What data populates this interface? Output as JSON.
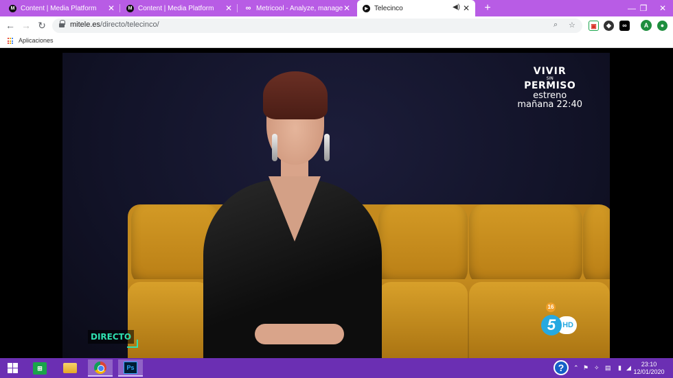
{
  "browser": {
    "tabs": [
      {
        "title": "Content | Media Platform",
        "favicon": "M"
      },
      {
        "title": "Content | Media Platform",
        "favicon": "M"
      },
      {
        "title": "Metricool - Analyze, manage and",
        "favicon": "∞"
      },
      {
        "title": "Telecinco",
        "favicon": "▶",
        "active": true
      }
    ],
    "new_tab": "+",
    "window_controls": {
      "minimize": "—",
      "restore": "❐",
      "close": "✕"
    },
    "address": {
      "domain": "mitele.es",
      "path": "/directo/telecinco/"
    },
    "profile_initial": "A",
    "bookmarks": {
      "apps_label": "Aplicaciones"
    }
  },
  "video": {
    "promo": {
      "line1": "VIVIR",
      "line2": "SIN",
      "line3": "PERMISO",
      "line4": "estreno",
      "line5": "mañana 22:40"
    },
    "live_label": "DIRECTO",
    "age_rating": "16",
    "channel_number": "5",
    "channel_hd": "HD"
  },
  "taskbar": {
    "store_label": "⊞",
    "ps_label": "Ps",
    "help_label": "?",
    "clock": {
      "time": "23:10",
      "date": "12/01/2020"
    }
  },
  "colors": {
    "tabstrip": "#b85ce5",
    "taskbar": "#6b2fb3",
    "live_accent": "#2fe1b0",
    "channel_blue": "#27a9e1"
  }
}
